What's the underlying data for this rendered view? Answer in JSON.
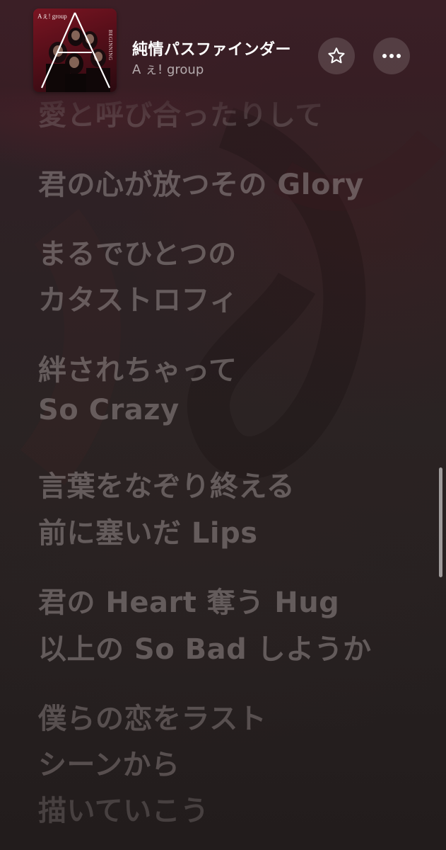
{
  "now_playing": {
    "title": "純情パスファインダー",
    "artist": "A ぇ! group",
    "artwork": {
      "logo_text": "Aぇ! group",
      "side_text": "BEGINNING",
      "icon": "album-artwork"
    }
  },
  "buttons": {
    "favorite": {
      "icon": "star-outline-icon"
    },
    "more": {
      "icon": "ellipsis-icon"
    }
  },
  "lyrics": {
    "lines": [
      "愛と呼び合ったりして",
      "君の心が放つその Glory",
      "まるでひとつの",
      "カタストロフィ",
      "絆されちゃって",
      "So Crazy",
      "言葉をなぞり終える",
      "前に塞いだ Lips",
      "君の Heart 奪う Hug",
      "以上の So Bad しようか",
      "僕らの恋をラスト",
      "シーンから",
      "描いていこう"
    ]
  },
  "colors": {
    "background_top": "#3a1f26",
    "background_bottom": "#221c1c",
    "lyric_text": "#968c8c",
    "title_text": "#ffffff"
  }
}
